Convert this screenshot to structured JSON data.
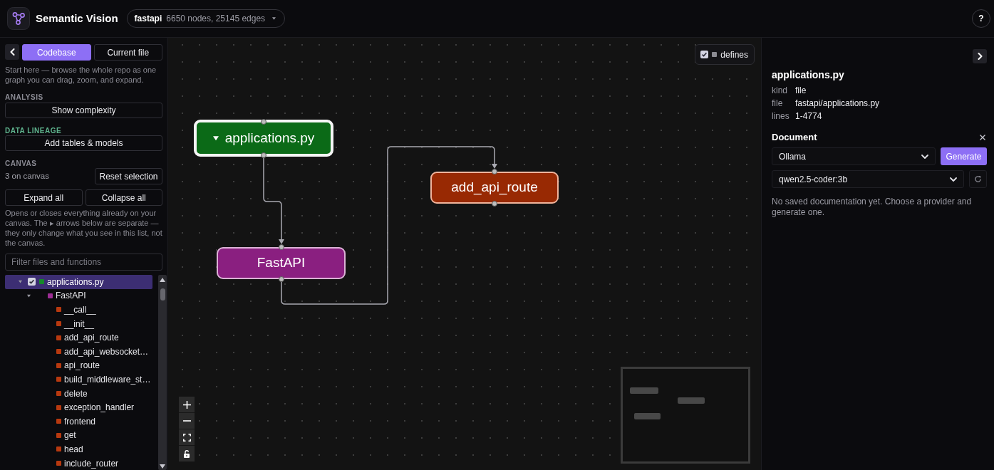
{
  "header": {
    "title": "Semantic Vision",
    "repo": {
      "name": "fastapi",
      "stats": "6650 nodes, 25145 edges"
    },
    "help_button": "?"
  },
  "left_panel": {
    "tabs": [
      {
        "label": "Codebase",
        "selected": true
      },
      {
        "label": "Current file",
        "selected": false
      }
    ],
    "intro": "Start here — browse the whole repo as one graph you can drag, zoom, and expand.",
    "analysis": {
      "heading": "ANALYSIS",
      "button": "Show complexity"
    },
    "data_lineage": {
      "heading": "DATA LINEAGE",
      "button": "Add tables & models"
    },
    "canvas": {
      "heading": "CANVAS",
      "count": "3 on canvas",
      "reset_button": "Reset selection",
      "expand_button": "Expand all",
      "collapse_button": "Collapse all",
      "note": "Opens or closes everything already on your canvas. The ▸ arrows below are separate — they only change what you see in this list, not the canvas."
    },
    "filter": {
      "placeholder": "Filter files and functions"
    },
    "tree": [
      {
        "label": "applications.py",
        "kind": "file",
        "selected": true,
        "checked": true,
        "expanded": true,
        "children": [
          {
            "label": "FastAPI",
            "kind": "class",
            "selected": false,
            "expanded": true,
            "children": [
              {
                "label": "__call__",
                "kind": "function",
                "selected": false
              },
              {
                "label": "__init__",
                "kind": "function",
                "selected": false
              },
              {
                "label": "add_api_route",
                "kind": "function",
                "selected": false
              },
              {
                "label": "add_api_websocket…",
                "kind": "function",
                "selected": false
              },
              {
                "label": "api_route",
                "kind": "function",
                "selected": false
              },
              {
                "label": "build_middleware_st…",
                "kind": "function",
                "selected": false
              },
              {
                "label": "delete",
                "kind": "function",
                "selected": false
              },
              {
                "label": "exception_handler",
                "kind": "function",
                "selected": false
              },
              {
                "label": "frontend",
                "kind": "function",
                "selected": false
              },
              {
                "label": "get",
                "kind": "function",
                "selected": false
              },
              {
                "label": "head",
                "kind": "function",
                "selected": false
              },
              {
                "label": "include_router",
                "kind": "function",
                "selected": false
              }
            ]
          }
        ]
      }
    ]
  },
  "canvas": {
    "legend": [
      {
        "label": "defines",
        "checked": true
      }
    ],
    "nodes": [
      {
        "label": "applications.py",
        "kind": "file",
        "selected": true,
        "expanded": true
      },
      {
        "label": "FastAPI",
        "kind": "class",
        "selected": false
      },
      {
        "label": "add_api_route",
        "kind": "function",
        "selected": false
      }
    ]
  },
  "details": {
    "title": "applications.py",
    "properties": [
      {
        "key": "kind",
        "value": "file"
      },
      {
        "key": "file",
        "value": "fastapi/applications.py"
      },
      {
        "key": "lines",
        "value": "1-4774"
      }
    ]
  },
  "document": {
    "heading": "Document",
    "provider": "Ollama",
    "generate_button": "Generate",
    "model": "qwen2.5-coder:3b",
    "message": "No saved documentation yet. Choose a provider and generate one."
  }
}
